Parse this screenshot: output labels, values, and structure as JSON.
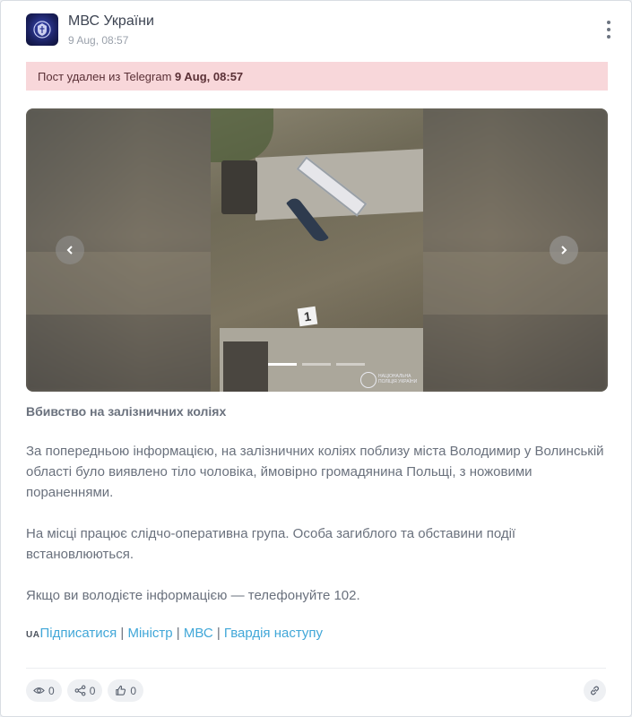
{
  "channel": {
    "name": "МВС України",
    "date": "9 Aug, 08:57"
  },
  "banner": {
    "text": "Пост удален из Telegram ",
    "date": "9 Aug, 08:57"
  },
  "media": {
    "watermark": "НАЦІОНАЛЬНА ПОЛІЦІЯ УКРАЇНИ",
    "marker": "1",
    "slides": [
      {
        "active": true
      },
      {
        "active": false
      },
      {
        "active": false
      }
    ]
  },
  "post": {
    "title": "Вбивство на залізничних коліях",
    "paragraph1": "За попередньою інформацією, на залізничних коліях поблизу міста Володимир у Волинській області було виявлено тіло чоловіка, ймовірно громадянина Польщі, з ножовими пораненнями.",
    "paragraph2": "На місці працює слідчо-оперативна група. Особа загиблого та обставини події встановлюються.",
    "paragraph3": "Якщо ви володієте інформацією — телефонуйте 102."
  },
  "links": {
    "flag": "UA",
    "subscribe": "Підписатися",
    "minister": "Міністр",
    "mvs": "МВС",
    "guard": "Гвардія наступу",
    "separator": " | "
  },
  "stats": {
    "views": "0",
    "shares": "0",
    "reactions": "0"
  },
  "colors": {
    "accent_link": "#41a7d8",
    "banner_bg": "#f8d7da"
  }
}
